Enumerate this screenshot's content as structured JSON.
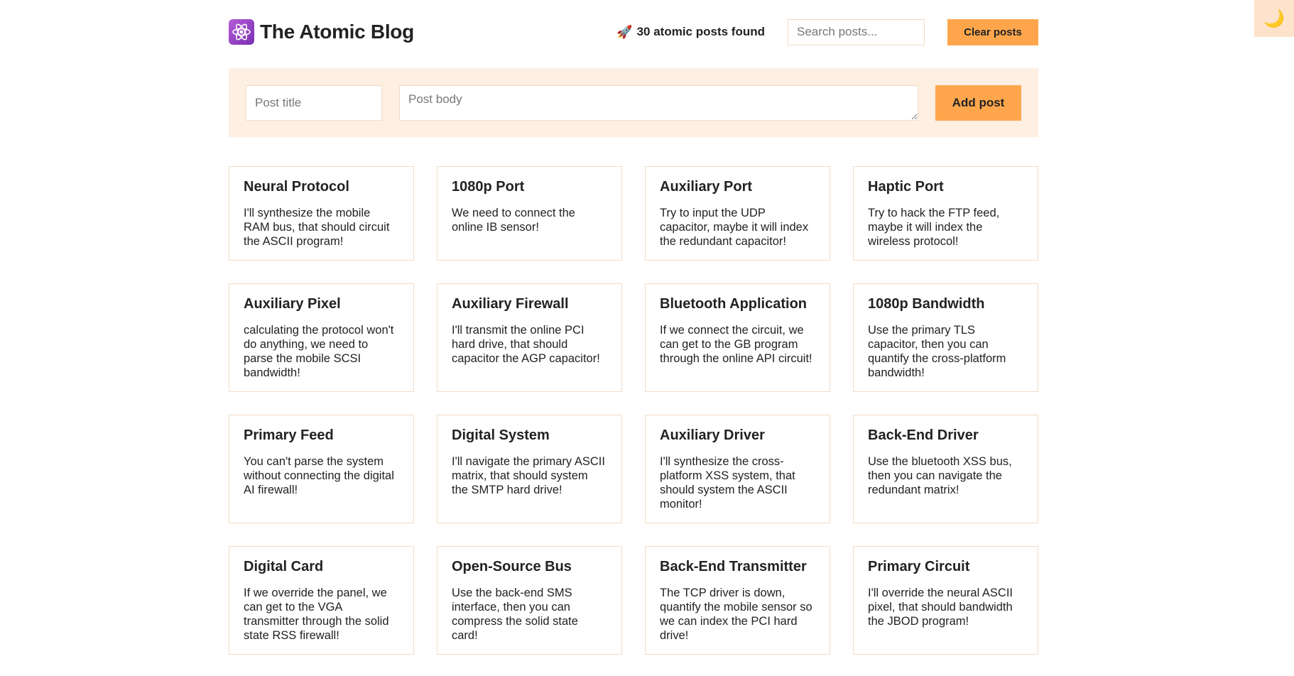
{
  "header": {
    "title": "The Atomic Blog",
    "logo_icon": "atom-icon",
    "results_icon": "rocket-icon",
    "results_emoji": "🚀",
    "results_text": "30 atomic posts found",
    "search_placeholder": "Search posts...",
    "clear_label": "Clear posts",
    "theme_toggle_icon": "moon-icon",
    "theme_toggle_glyph": "🌙"
  },
  "form": {
    "title_placeholder": "Post title",
    "body_placeholder": "Post body",
    "add_label": "Add post"
  },
  "colors": {
    "accent": "#ffa64d",
    "panel": "#fdefe2",
    "border": "#f2dcc6"
  },
  "posts": [
    {
      "title": "Neural Protocol",
      "body": "I'll synthesize the mobile RAM bus, that should circuit the ASCII program!"
    },
    {
      "title": "1080p Port",
      "body": "We need to connect the online IB sensor!"
    },
    {
      "title": "Auxiliary Port",
      "body": "Try to input the UDP capacitor, maybe it will index the redundant capacitor!"
    },
    {
      "title": "Haptic Port",
      "body": "Try to hack the FTP feed, maybe it will index the wireless protocol!"
    },
    {
      "title": "Auxiliary Pixel",
      "body": "calculating the protocol won't do anything, we need to parse the mobile SCSI bandwidth!"
    },
    {
      "title": "Auxiliary Firewall",
      "body": "I'll transmit the online PCI hard drive, that should capacitor the AGP capacitor!"
    },
    {
      "title": "Bluetooth Application",
      "body": "If we connect the circuit, we can get to the GB program through the online API circuit!"
    },
    {
      "title": "1080p Bandwidth",
      "body": "Use the primary TLS capacitor, then you can quantify the cross-platform bandwidth!"
    },
    {
      "title": "Primary Feed",
      "body": "You can't parse the system without connecting the digital AI firewall!"
    },
    {
      "title": "Digital System",
      "body": "I'll navigate the primary ASCII matrix, that should system the SMTP hard drive!"
    },
    {
      "title": "Auxiliary Driver",
      "body": "I'll synthesize the cross-platform XSS system, that should system the ASCII monitor!"
    },
    {
      "title": "Back-End Driver",
      "body": "Use the bluetooth XSS bus, then you can navigate the redundant matrix!"
    },
    {
      "title": "Digital Card",
      "body": "If we override the panel, we can get to the VGA transmitter through the solid state RSS firewall!"
    },
    {
      "title": "Open-Source Bus",
      "body": "Use the back-end SMS interface, then you can compress the solid state card!"
    },
    {
      "title": "Back-End Transmitter",
      "body": "The TCP driver is down, quantify the mobile sensor so we can index the PCI hard drive!"
    },
    {
      "title": "Primary Circuit",
      "body": "I'll override the neural ASCII pixel, that should bandwidth the JBOD program!"
    }
  ]
}
